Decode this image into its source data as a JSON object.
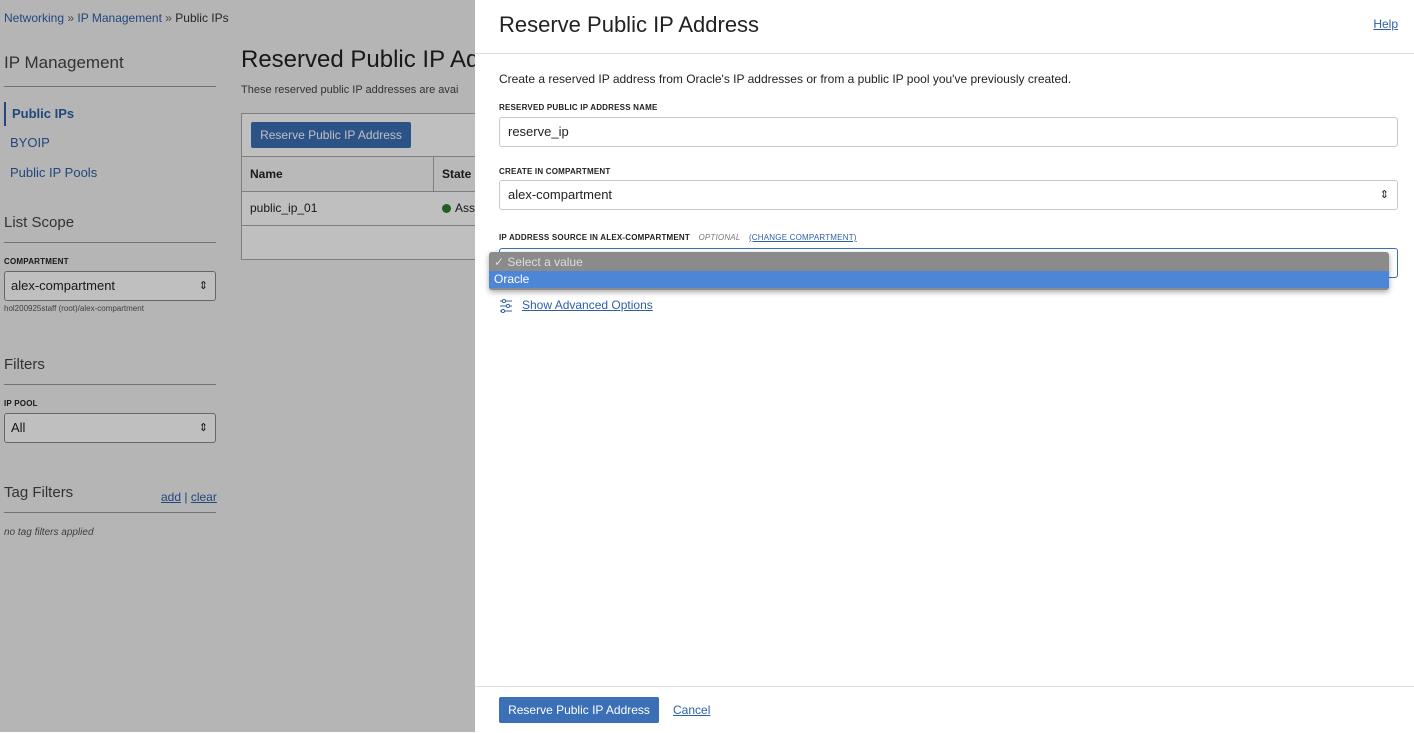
{
  "breadcrumb": {
    "items": [
      "Networking",
      "IP Management",
      "Public IPs"
    ],
    "sep": "»"
  },
  "sidebar": {
    "title": "IP Management",
    "nav": [
      {
        "label": "Public IPs"
      },
      {
        "label": "BYOIP"
      },
      {
        "label": "Public IP Pools"
      }
    ],
    "list_scope_title": "List Scope",
    "compartment_label": "COMPARTMENT",
    "compartment_value": "alex-compartment",
    "compartment_path": "hol200925staff (root)/alex-compartment",
    "filters_title": "Filters",
    "ip_pool_label": "IP POOL",
    "ip_pool_value": "All",
    "tag_filters_title": "Tag Filters",
    "tag_add": "add",
    "tag_pipe": "|",
    "tag_clear": "clear",
    "no_tags": "no tag filters applied"
  },
  "main": {
    "title": "Reserved Public IP Ad",
    "description": "These reserved public IP addresses are avai",
    "reserve_button": "Reserve Public IP Address",
    "table": {
      "headers": [
        "Name",
        "State"
      ],
      "rows": [
        {
          "name": "public_ip_01",
          "state": "Ass"
        }
      ]
    }
  },
  "panel": {
    "title": "Reserve Public IP Address",
    "help": "Help",
    "intro": "Create a reserved IP address from Oracle's IP addresses or from a public IP pool you've previously created.",
    "name_label": "RESERVED PUBLIC IP ADDRESS NAME",
    "name_value": "reserve_ip",
    "compartment_label": "CREATE IN COMPARTMENT",
    "compartment_value": "alex-compartment",
    "source_label_prefix": "IP ADDRESS SOURCE IN",
    "source_label_bold": "ALEX-COMPARTMENT",
    "optional": "OPTIONAL",
    "change_compartment": "(CHANGE COMPARTMENT)",
    "dropdown_options": [
      "✓ Select a value",
      "Oracle"
    ],
    "advanced_options": "Show Advanced Options",
    "submit_button": "Reserve Public IP Address",
    "cancel": "Cancel"
  },
  "colors": {
    "accent": "#3b6fb6",
    "link": "#2d5fa6",
    "status_green": "#2e7d32",
    "dropdown_highlight": "#4d86d6"
  }
}
